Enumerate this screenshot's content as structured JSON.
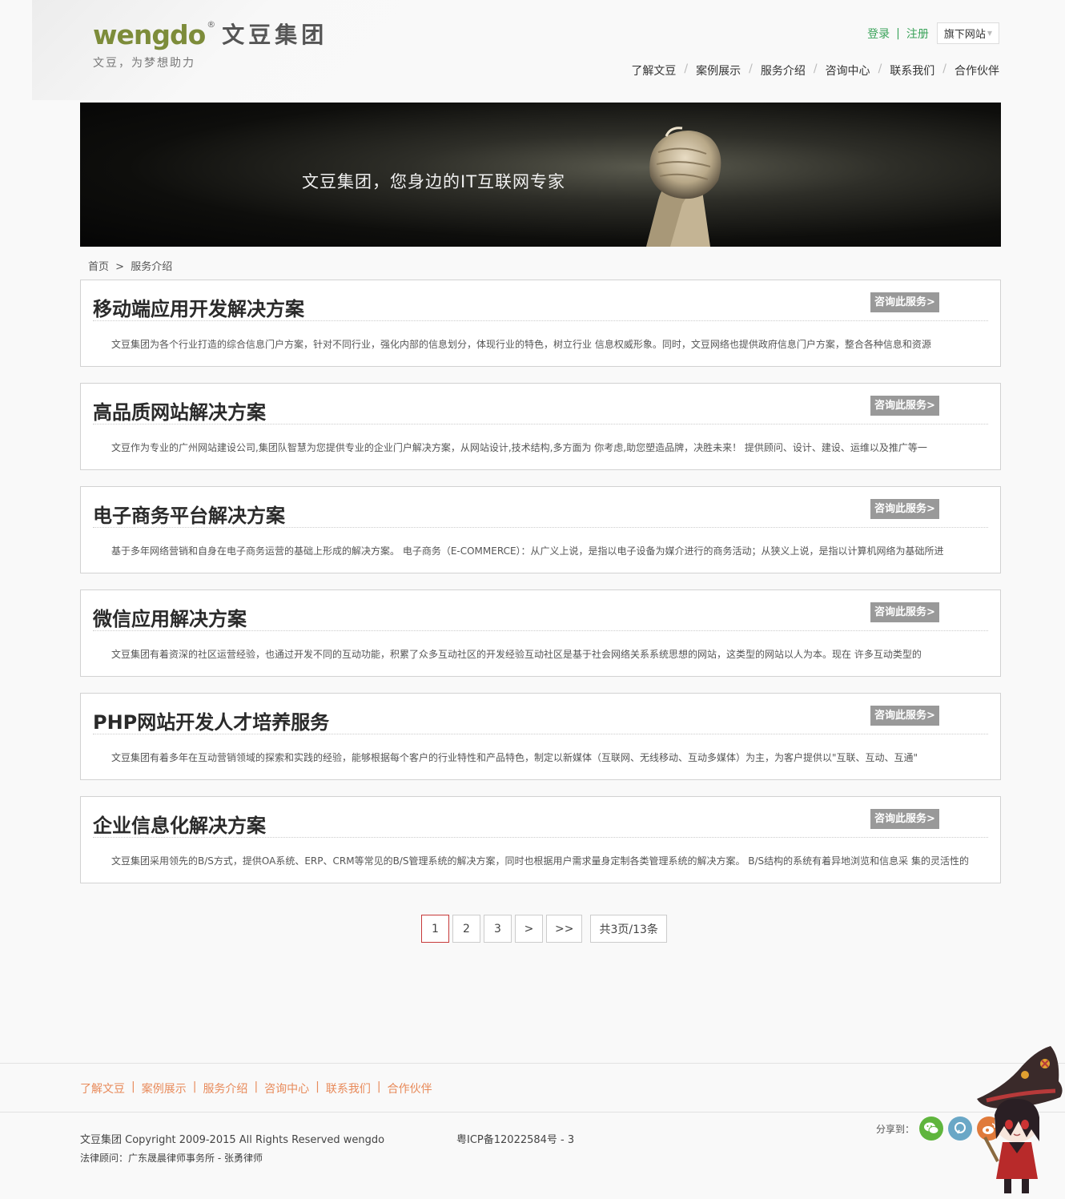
{
  "header": {
    "logo_en": "wengdo",
    "logo_reg": "®",
    "logo_cn": "文豆集团",
    "slogan": "文豆，为梦想助力",
    "login": "登录",
    "separator": "|",
    "register": "注册",
    "sites_dropdown": "旗下网站",
    "nav": [
      "了解文豆",
      "案例展示",
      "服务介绍",
      "咨询中心",
      "联系我们",
      "合作伙伴"
    ],
    "nav_slash": "/"
  },
  "banner": {
    "text": "文豆集团，您身边的IT互联网专家"
  },
  "breadcrumb": {
    "home": "首页",
    "arrow": ">",
    "current": "服务介绍"
  },
  "services": [
    {
      "title": "移动端应用开发解决方案",
      "button": "咨询此服务>",
      "desc": "文豆集团为各个行业打造的综合信息门户方案，针对不同行业，强化内部的信息划分，体现行业的特色，树立行业 信息权威形象。同时，文豆网络也提供政府信息门户方案，整合各种信息和资源"
    },
    {
      "title": "高品质网站解决方案",
      "button": "咨询此服务>",
      "desc": "文豆作为专业的广州网站建设公司,集团队智慧为您提供专业的企业门户解决方案，从网站设计,技术结构,多方面为 你考虑,助您塑造品牌，决胜未来！ 提供顾问、设计、建设、运维以及推广等一"
    },
    {
      "title": "电子商务平台解决方案",
      "button": "咨询此服务>",
      "desc": "基于多年网络营销和自身在电子商务运营的基础上形成的解决方案。 电子商务（E-COMMERCE）：从广义上说，是指以电子设备为媒介进行的商务活动；从狭义上说，是指以计算机网络为基础所进"
    },
    {
      "title": "微信应用解决方案",
      "button": "咨询此服务>",
      "desc": "文豆集团有着资深的社区运营经验，也通过开发不同的互动功能，积累了众多互动社区的开发经验互动社区是基于社会网络关系系统思想的网站，这类型的网站以人为本。现在 许多互动类型的"
    },
    {
      "title": "PHP网站开发人才培养服务",
      "button": "咨询此服务>",
      "desc": "文豆集团有着多年在互动营销领域的探索和实践的经验，能够根据每个客户的行业特性和产品特色，制定以新媒体（互联网、无线移动、互动多媒体）为主，为客户提供以\"互联、互动、互通\""
    },
    {
      "title": "企业信息化解决方案",
      "button": "咨询此服务>",
      "desc": "文豆集团采用领先的B/S方式，提供OA系统、ERP、CRM等常见的B/S管理系统的解决方案，同时也根据用户需求量身定制各类管理系统的解决方案。 B/S结构的系统有着异地浏览和信息采 集的灵活性的"
    }
  ],
  "pagination": {
    "pages": [
      "1",
      "2",
      "3"
    ],
    "current": "1",
    "next": ">",
    "last": ">>",
    "total": "共3页/13条"
  },
  "footer": {
    "nav": [
      "了解文豆",
      "案例展示",
      "服务介绍",
      "咨询中心",
      "联系我们",
      "合作伙伴"
    ],
    "nav_bar": "|",
    "copyright": "文豆集团 Copyright 2009-2015 All Rights Reserved wengdo",
    "icp": "粤ICP备12022584号 - 3",
    "legal": "法律顾问：广东晟晨律师事务所 - 张勇律师",
    "share_label": "分享到：",
    "share_icons": [
      "wechat-icon",
      "qzone-icon",
      "weibo-icon"
    ]
  },
  "colors": {
    "logo_green": "#7d8c3a",
    "login_green": "#3aa35a",
    "footer_orange": "#e88a5a",
    "button_gray": "#999999",
    "pager_active_border": "#c73a3a"
  }
}
